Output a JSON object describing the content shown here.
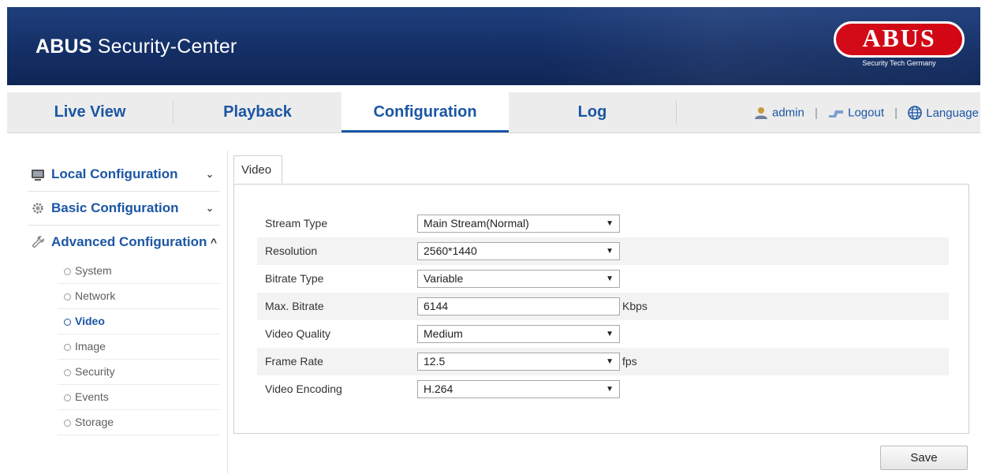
{
  "header": {
    "brand_bold": "ABUS",
    "brand_rest": " Security-Center",
    "logo_text": "ABUS",
    "logo_tagline": "Security Tech Germany"
  },
  "nav": {
    "tabs": [
      {
        "label": "Live View"
      },
      {
        "label": "Playback"
      },
      {
        "label": "Configuration",
        "active": true
      },
      {
        "label": "Log"
      }
    ],
    "user": "admin",
    "logout": "Logout",
    "language": "Language",
    "separator": "|"
  },
  "sidebar": {
    "sections": [
      {
        "label": "Local Configuration",
        "chevron": "⌄",
        "icon": "monitor-icon"
      },
      {
        "label": "Basic Configuration",
        "chevron": "⌄",
        "icon": "gear-icon"
      },
      {
        "label": "Advanced Configuration",
        "chevron": "^",
        "icon": "wrench-icon"
      }
    ],
    "items": [
      {
        "label": "System"
      },
      {
        "label": "Network"
      },
      {
        "label": "Video",
        "active": true
      },
      {
        "label": "Image"
      },
      {
        "label": "Security"
      },
      {
        "label": "Events"
      },
      {
        "label": "Storage"
      }
    ]
  },
  "content": {
    "tab": "Video",
    "rows": [
      {
        "label": "Stream Type",
        "value": "Main Stream(Normal)",
        "type": "select",
        "unit": ""
      },
      {
        "label": "Resolution",
        "value": "2560*1440",
        "type": "select",
        "unit": ""
      },
      {
        "label": "Bitrate Type",
        "value": "Variable",
        "type": "select",
        "unit": ""
      },
      {
        "label": "Max. Bitrate",
        "value": "6144",
        "type": "input",
        "unit": "Kbps"
      },
      {
        "label": "Video Quality",
        "value": "Medium",
        "type": "select",
        "unit": ""
      },
      {
        "label": "Frame Rate",
        "value": "12.5",
        "type": "select",
        "unit": "fps"
      },
      {
        "label": "Video Encoding",
        "value": "H.264",
        "type": "select",
        "unit": ""
      }
    ],
    "save_label": "Save"
  },
  "colors": {
    "banner": "#142f66",
    "accent": "#1b56a4",
    "logo_red": "#d1000e"
  }
}
